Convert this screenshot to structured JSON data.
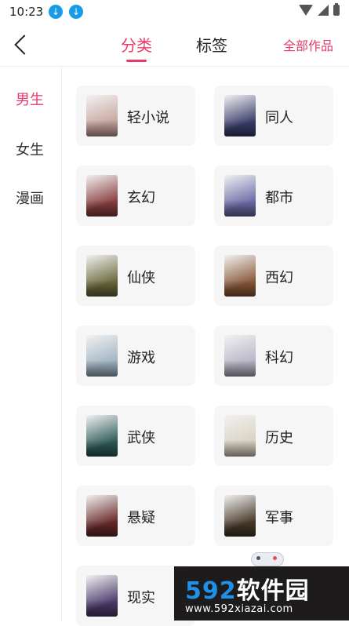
{
  "status_bar": {
    "time": "10:23"
  },
  "header": {
    "tabs": [
      "分类",
      "标签"
    ],
    "all_works": "全部作品"
  },
  "sidebar": {
    "items": [
      "男生",
      "女生",
      "漫画"
    ]
  },
  "categories": [
    {
      "label": "轻小说",
      "cover_color": "#c9a6a0"
    },
    {
      "label": "同人",
      "cover_color": "#3b3f6d"
    },
    {
      "label": "玄幻",
      "cover_color": "#8a3f3f"
    },
    {
      "label": "都市",
      "cover_color": "#6c6ea8"
    },
    {
      "label": "仙侠",
      "cover_color": "#6b6a3c"
    },
    {
      "label": "西幻",
      "cover_color": "#8b5a3a"
    },
    {
      "label": "游戏",
      "cover_color": "#9fb4c4"
    },
    {
      "label": "科幻",
      "cover_color": "#b8b5c8"
    },
    {
      "label": "武侠",
      "cover_color": "#2f5b5a"
    },
    {
      "label": "历史",
      "cover_color": "#d8d2c2"
    },
    {
      "label": "悬疑",
      "cover_color": "#6b2a2a"
    },
    {
      "label": "军事",
      "cover_color": "#4a3a2a"
    },
    {
      "label": "现实",
      "cover_color": "#4c3d6e"
    }
  ],
  "watermark": {
    "brand_num": "592",
    "brand_text": "软件园",
    "url": "www.592xiazai.com"
  },
  "colors": {
    "accent": "#e8396b",
    "download_icon": "#1a9be8"
  }
}
